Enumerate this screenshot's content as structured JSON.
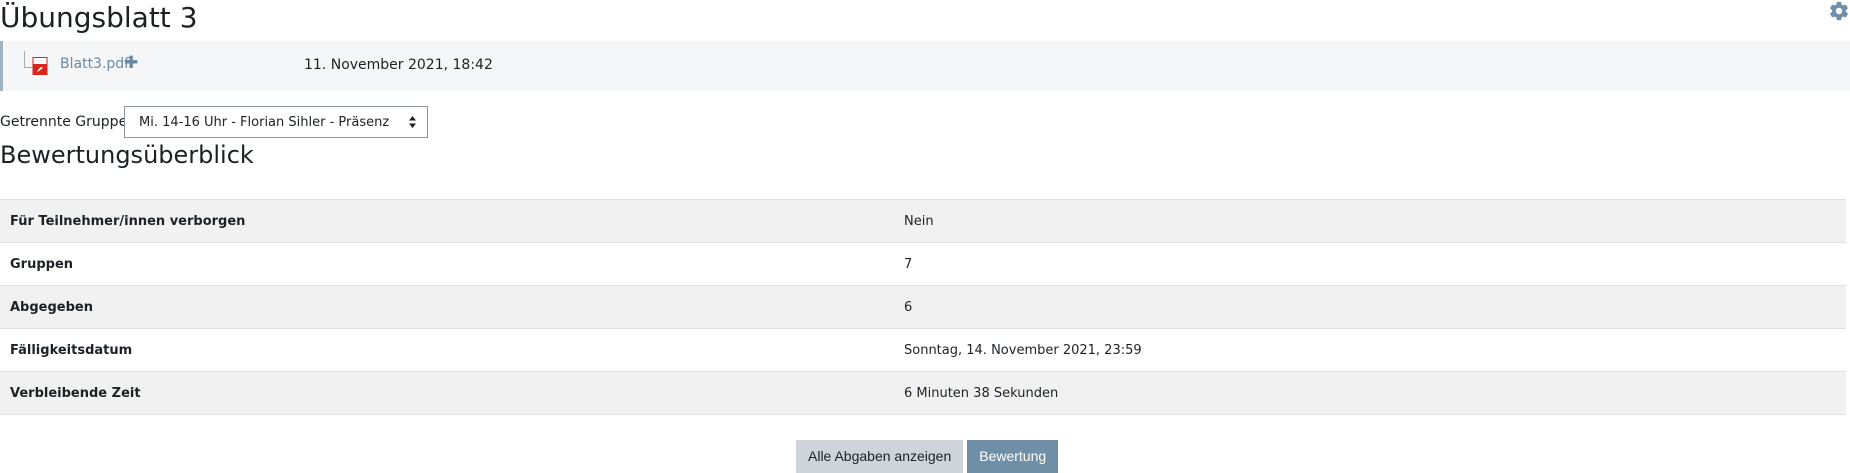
{
  "page": {
    "title": "Übungsblatt 3"
  },
  "colors": {
    "accent": "#6f8fa6",
    "link": "#6b8aa1",
    "pdf_red": "#d9261c",
    "panel_bg": "#f4f6f8",
    "table_stripe": "#f1f1f1"
  },
  "file": {
    "icon": "pdf-icon",
    "name": "Blatt3.pdf",
    "expand_icon": "plus-icon",
    "date": "11. November 2021, 18:42"
  },
  "groups": {
    "label": "Getrennte Gruppen",
    "selected": "Mi. 14-16 Uhr - Florian Sihler - Präsenz"
  },
  "summary": {
    "title": "Bewertungsüberblick",
    "rows": [
      {
        "label": "Für Teilnehmer/innen verborgen",
        "value": "Nein"
      },
      {
        "label": "Gruppen",
        "value": "7"
      },
      {
        "label": "Abgegeben",
        "value": "6"
      },
      {
        "label": "Fälligkeitsdatum",
        "value": "Sonntag, 14. November 2021, 23:59"
      },
      {
        "label": "Verbleibende Zeit",
        "value": "6 Minuten 38 Sekunden"
      }
    ]
  },
  "actions": {
    "view_all": "Alle Abgaben anzeigen",
    "grade": "Bewertung"
  },
  "icons": {
    "settings": "gear-icon"
  }
}
